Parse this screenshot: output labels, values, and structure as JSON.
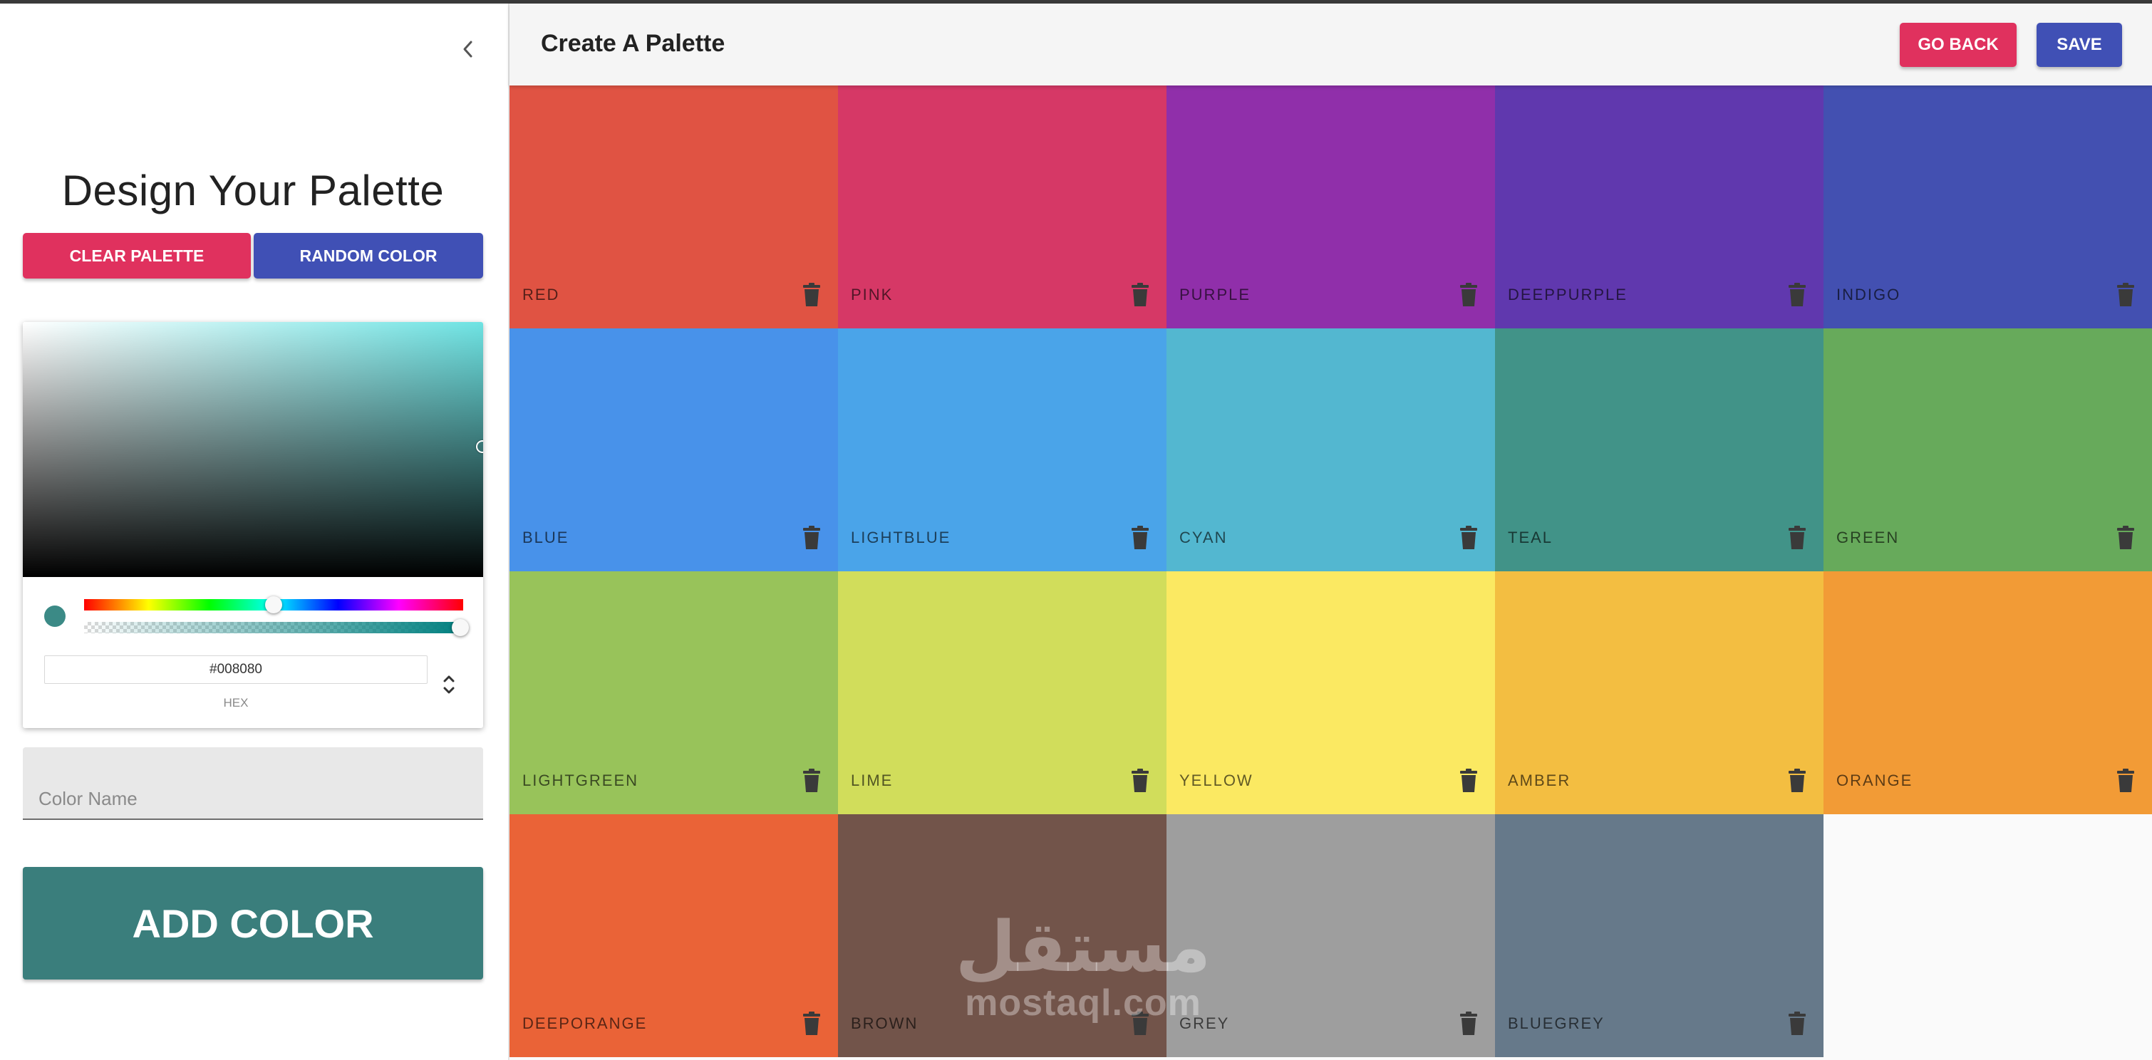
{
  "sidebar": {
    "collapse_icon": "chevron-left-icon",
    "title": "Design Your Palette",
    "clear_label": "CLEAR PALETTE",
    "random_label": "RANDOM COLOR",
    "picker": {
      "hex_value": "#008080",
      "hex_label": "HEX",
      "preview_color": "#3b8a86"
    },
    "color_name_placeholder": "Color Name",
    "add_label": "ADD COLOR",
    "add_color": "#3a7e7c"
  },
  "appbar": {
    "title": "Create A Palette",
    "go_back_label": "GO BACK",
    "save_label": "SAVE"
  },
  "colors": {
    "accent_pink": "#e0315e",
    "accent_indigo": "#4050b5"
  },
  "palette": [
    {
      "name": "RED",
      "color": "#e05343"
    },
    {
      "name": "PINK",
      "color": "#d63866"
    },
    {
      "name": "PURPLE",
      "color": "#902faa"
    },
    {
      "name": "DEEPPURPLE",
      "color": "#6038ae"
    },
    {
      "name": "INDIGO",
      "color": "#4350b1"
    },
    {
      "name": "BLUE",
      "color": "#4892ea"
    },
    {
      "name": "LIGHTBLUE",
      "color": "#4aa4e9"
    },
    {
      "name": "CYAN",
      "color": "#53b7d0"
    },
    {
      "name": "TEAL",
      "color": "#419388"
    },
    {
      "name": "GREEN",
      "color": "#67aa5b"
    },
    {
      "name": "LIGHTGREEN",
      "color": "#98c35a"
    },
    {
      "name": "LIME",
      "color": "#d1dd5b"
    },
    {
      "name": "YELLOW",
      "color": "#fbe962"
    },
    {
      "name": "AMBER",
      "color": "#f3be41"
    },
    {
      "name": "ORANGE",
      "color": "#f29b36"
    },
    {
      "name": "DEEPORANGE",
      "color": "#ea6337"
    },
    {
      "name": "BROWN",
      "color": "#72544a"
    },
    {
      "name": "GREY",
      "color": "#9e9e9e"
    },
    {
      "name": "BLUEGREY",
      "color": "#66798a"
    }
  ],
  "watermark": {
    "arabic": "مستقل",
    "latin": "mostaql.com"
  }
}
